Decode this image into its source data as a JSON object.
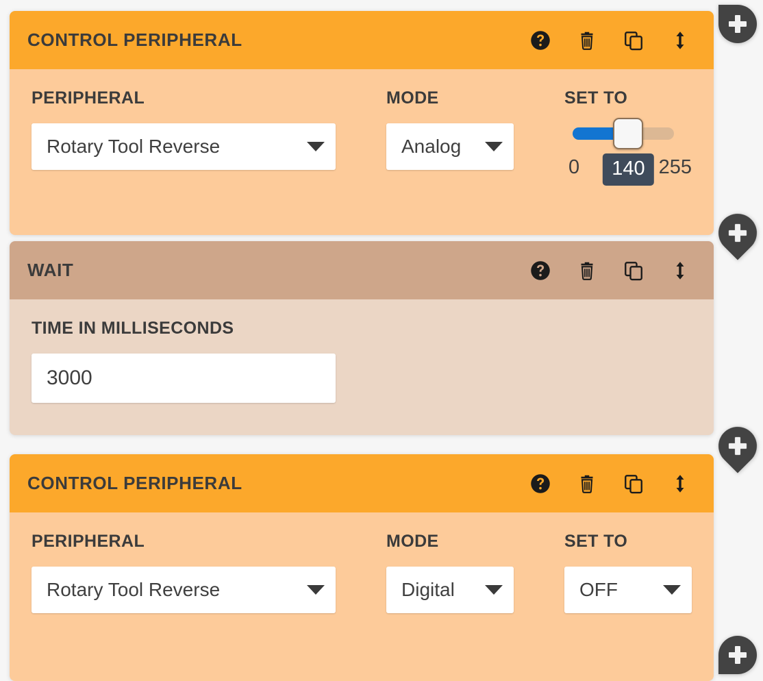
{
  "page": {
    "background_color": "#f6f6f6"
  },
  "icons": {
    "help": "help-circle-icon",
    "delete": "trash-icon",
    "duplicate": "copy-icon",
    "reorder": "vertical-resize-arrow-icon",
    "add": "plus-icon",
    "dropdown": "chevron-down-icon"
  },
  "blocks": [
    {
      "id": "control-peripheral-1",
      "title": "CONTROL PERIPHERAL",
      "header_color": "#fca82b",
      "body_color": "#fdcb9a",
      "fields": {
        "peripheral": {
          "label": "PERIPHERAL",
          "value": "Rotary Tool Reverse"
        },
        "mode": {
          "label": "MODE",
          "value": "Analog"
        },
        "set_to": {
          "label": "SET TO",
          "type": "slider",
          "value": "140",
          "min": "0",
          "max": "255",
          "fill_percent": 55,
          "fill_color": "#1375d1",
          "track_color": "#dcb894",
          "bubble_color": "#3f4b5b"
        }
      }
    },
    {
      "id": "wait-1",
      "title": "WAIT",
      "header_color": "#cea68a",
      "body_color": "#ebd6c5",
      "fields": {
        "time": {
          "label": "TIME IN MILLISECONDS",
          "value": "3000"
        }
      }
    },
    {
      "id": "control-peripheral-2",
      "title": "CONTROL PERIPHERAL",
      "header_color": "#fca82b",
      "body_color": "#fdcb9a",
      "fields": {
        "peripheral": {
          "label": "PERIPHERAL",
          "value": "Rotary Tool Reverse"
        },
        "mode": {
          "label": "MODE",
          "value": "Digital"
        },
        "set_to": {
          "label": "SET TO",
          "type": "select",
          "value": "OFF"
        }
      }
    }
  ],
  "add_buttons": [
    {
      "id": "add-top",
      "label": "+"
    },
    {
      "id": "add-between-1",
      "label": "+"
    },
    {
      "id": "add-between-2",
      "label": "+"
    },
    {
      "id": "add-bottom",
      "label": "+"
    }
  ]
}
